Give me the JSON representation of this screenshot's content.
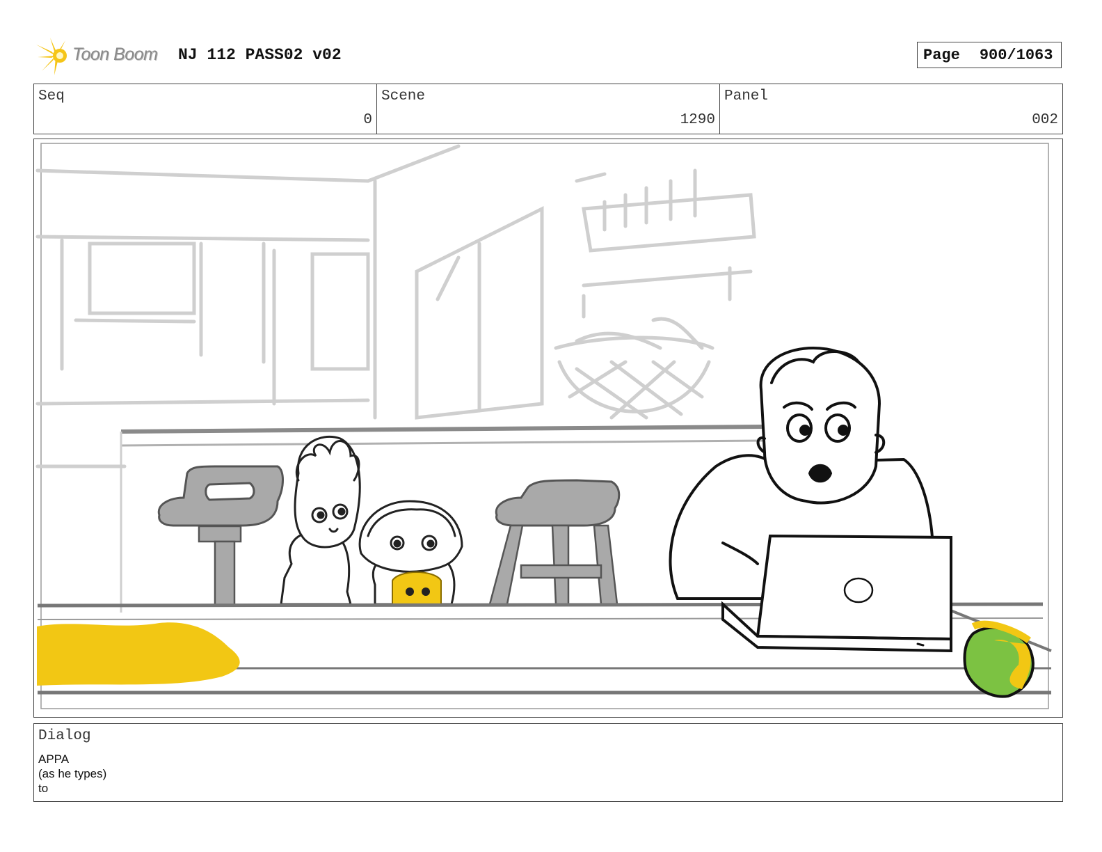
{
  "header": {
    "logo_text": "Toon Boom",
    "project_title": "NJ 112 PASS02 v02",
    "page_label": "Page",
    "page_number": "900/1063"
  },
  "info": {
    "seq_label": "Seq",
    "seq_value": "0",
    "scene_label": "Scene",
    "scene_value": "1290",
    "panel_label": "Panel",
    "panel_value": "002"
  },
  "dialog": {
    "label": "Dialog",
    "lines": [
      "APPA",
      "(as he types)",
      "to"
    ]
  },
  "colors": {
    "accent_yellow": "#f2c714",
    "mango_green": "#7cc242",
    "sketch_gray": "#c8c8c8"
  }
}
